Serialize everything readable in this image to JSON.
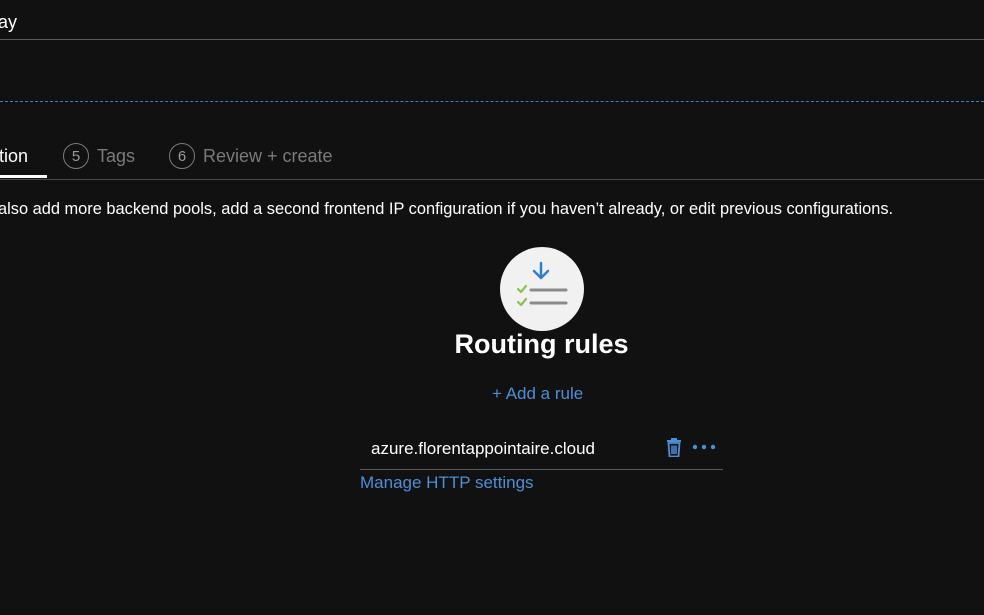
{
  "header": {
    "title_fragment": "ay"
  },
  "tabs": {
    "active_label": "tion",
    "items": [
      {
        "number": "5",
        "label": "Tags"
      },
      {
        "number": "6",
        "label": "Review + create"
      }
    ]
  },
  "description": "also add more backend pools, add a second frontend IP configuration if you haven’t already, or edit previous configurations.",
  "routing": {
    "icon": "routing-rules-icon",
    "heading": "Routing rules",
    "add_rule_label": "+ Add a rule",
    "rules": [
      {
        "name": "azure.florentappointaire.cloud",
        "actions": [
          "trash-icon",
          "more-icon"
        ]
      }
    ],
    "manage_link": "Manage HTTP settings"
  },
  "colors": {
    "background": "#111111",
    "accent": "#4a90d9",
    "check": "#8bc34a",
    "muted": "#7a7a7a"
  }
}
